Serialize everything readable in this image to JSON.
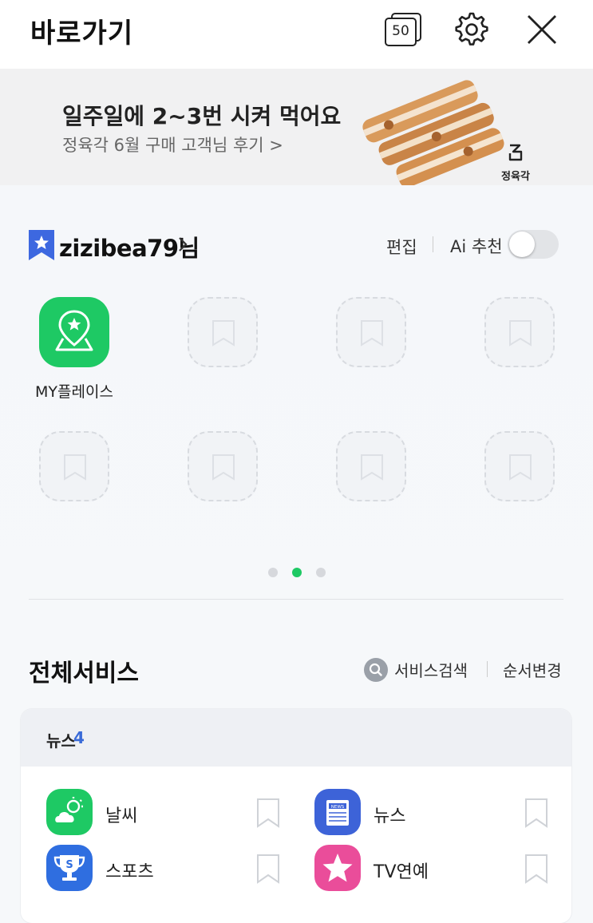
{
  "header": {
    "title": "바로가기",
    "tab_count": "50"
  },
  "banner": {
    "title": "일주일에 2~3번 시켜 먹어요",
    "subtitle": "정육각 6월 구매 고객님 후기 >",
    "brand": "정육각"
  },
  "favorites": {
    "user_label": "zizibea79님",
    "edit_label": "편집",
    "ai_label": "Ai 추천",
    "ai_enabled": false,
    "apps": [
      {
        "label": "MY플레이스",
        "color": "#1ec964"
      }
    ],
    "page_dots": 3,
    "active_page": 2
  },
  "services": {
    "title": "전체서비스",
    "search_label": "서비스검색",
    "order_label": "순서변경",
    "category": {
      "label": "뉴스",
      "count": "4",
      "items": [
        {
          "name": "날씨",
          "icon": "weather-icon",
          "color": "#1ec964"
        },
        {
          "name": "뉴스",
          "icon": "news-icon",
          "color": "#3d63d8"
        },
        {
          "name": "스포츠",
          "icon": "sports-trophy-icon",
          "color": "#2f6ee0"
        },
        {
          "name": "TV연예",
          "icon": "star-icon",
          "color": "#ea4d9a"
        }
      ]
    }
  }
}
